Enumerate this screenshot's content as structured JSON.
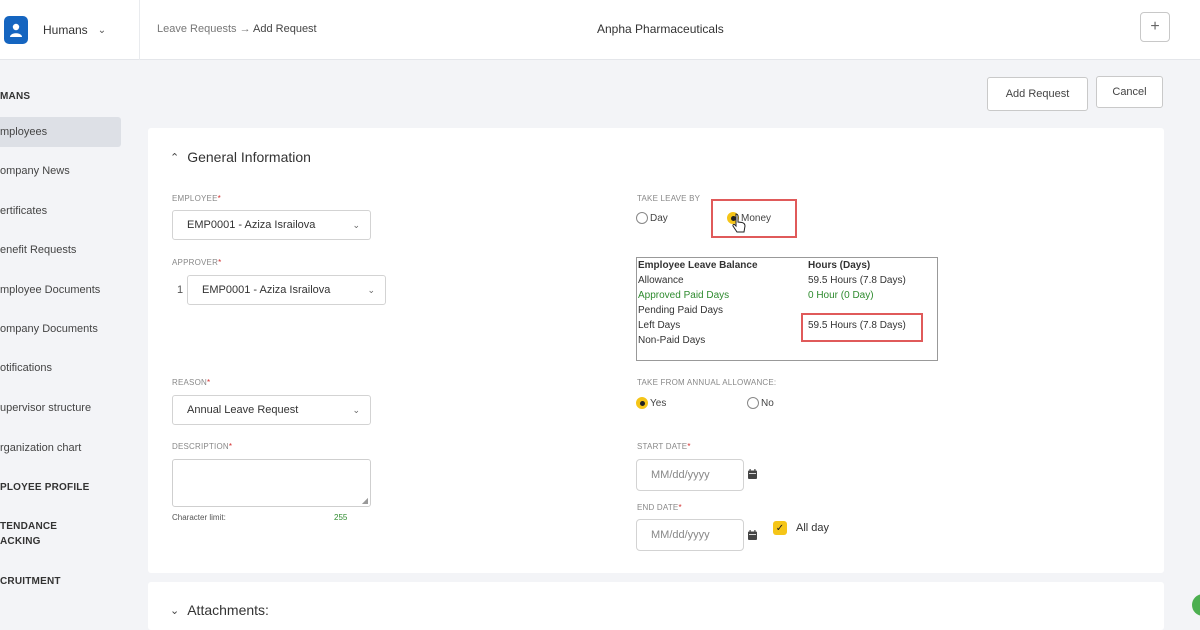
{
  "brand": {
    "name": "Humans"
  },
  "header": {
    "breadcrumb_parent": "Leave Requests",
    "breadcrumb_arrow": "→",
    "breadcrumb_current": "Add Request",
    "company": "Anpha Pharmaceuticals",
    "plus_label": "+"
  },
  "sidebar": {
    "section_humans": "MANS",
    "items": [
      "mployees",
      "ompany News",
      "ertificates",
      "enefit Requests",
      "mployee Documents",
      "ompany Documents",
      "otifications",
      "upervisor structure",
      "rganization chart"
    ],
    "section_profile": "PLOYEE PROFILE",
    "section_attendance_1": "TENDANCE",
    "section_attendance_2": "ACKING",
    "section_recruitment": "CRUITMENT"
  },
  "actions": {
    "add_request": "Add Request",
    "cancel": "Cancel"
  },
  "general": {
    "title": "General Information",
    "employee_label": "EMPLOYEE",
    "employee_value": "EMP0001 - Aziza Israilova",
    "approver_label": "APPROVER",
    "approver_index": "1",
    "approver_value": "EMP0001 - Aziza Israilova",
    "reason_label": "REASON",
    "reason_value": "Annual Leave Request",
    "description_label": "DESCRIPTION",
    "char_limit_label": "Character limit:",
    "char_limit_value": "255",
    "take_leave_label": "TAKE LEAVE BY",
    "take_leave_day": "Day",
    "take_leave_money": "Money",
    "take_leave_selected": "Money",
    "balance": {
      "col_left": "Employee Leave Balance",
      "col_right": "Hours (Days)",
      "rows": [
        {
          "name": "Allowance",
          "value": "59.5 Hours (7.8 Days)"
        },
        {
          "name": "Approved Paid Days",
          "value": "0 Hour (0 Day)"
        },
        {
          "name": "Pending Paid Days",
          "value": ""
        },
        {
          "name": "Left Days",
          "value": "59.5 Hours (7.8 Days)"
        },
        {
          "name": "Non-Paid Days",
          "value": ""
        }
      ]
    },
    "annual_label": "TAKE FROM ANNUAL ALLOWANCE:",
    "annual_yes": "Yes",
    "annual_no": "No",
    "annual_selected": "Yes",
    "start_label": "START DATE",
    "start_placeholder": "MM/dd/yyyy",
    "end_label": "END DATE",
    "end_placeholder": "MM/dd/yyyy",
    "all_day_label": "All day",
    "all_day_checked": true,
    "required_mark": "*"
  },
  "attachments": {
    "title": "Attachments:"
  },
  "colors": {
    "accent": "#f5c518",
    "brand": "#1565c0",
    "highlight": "#e05a5a",
    "success": "#2e8b2e"
  }
}
